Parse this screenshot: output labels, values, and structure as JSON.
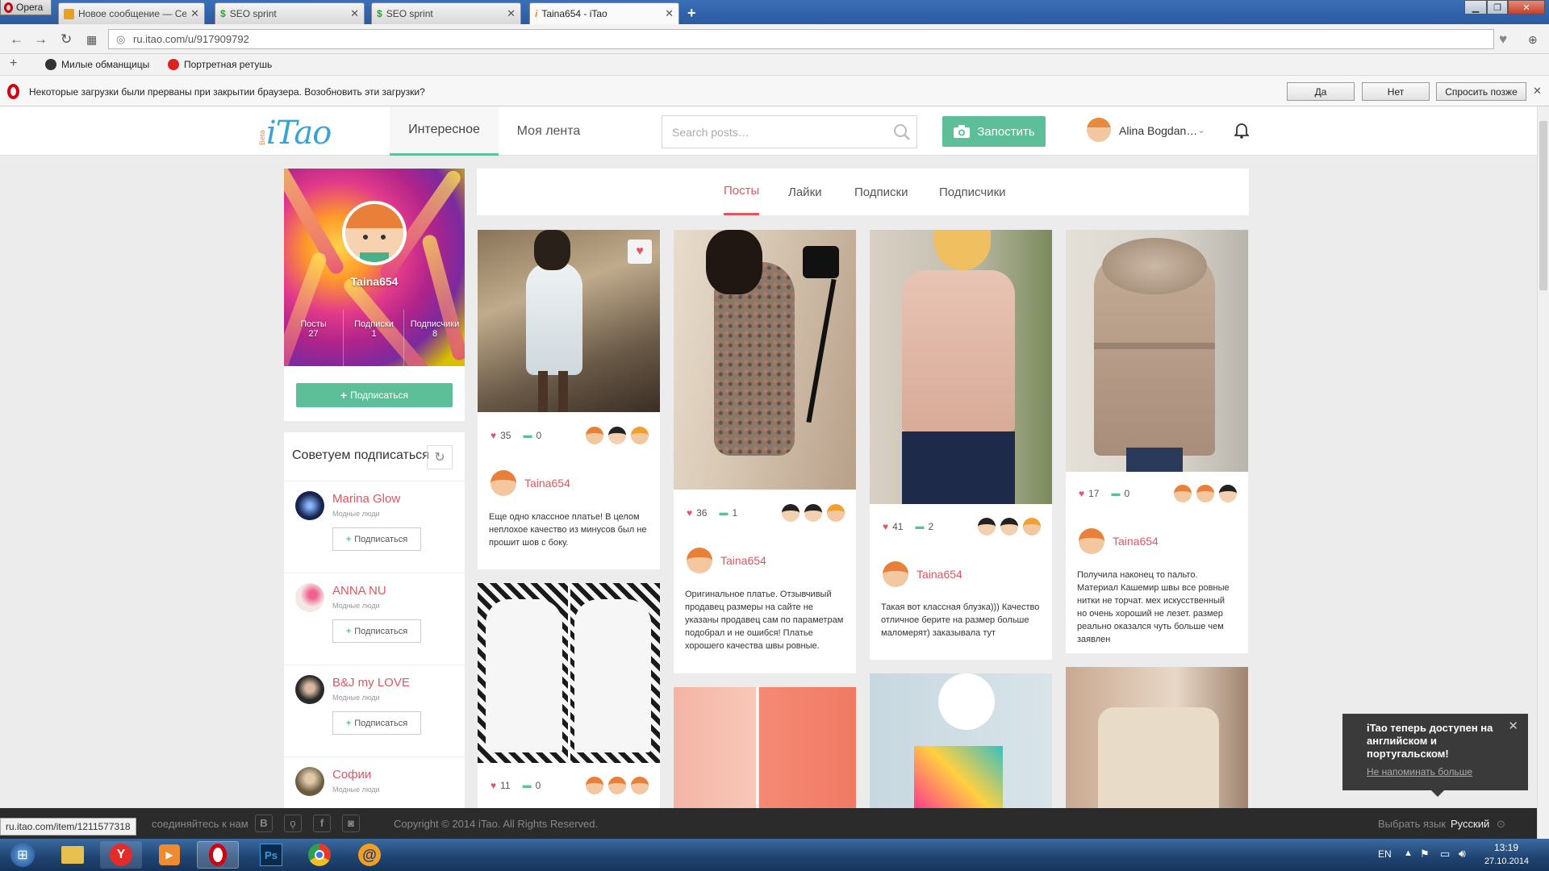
{
  "browser": {
    "opera_label": "Opera",
    "tabs": [
      {
        "title": "Новое сообщение — Се",
        "color": "#e8a020"
      },
      {
        "title": "SEO sprint",
        "color": "#3a9a3a"
      },
      {
        "title": "SEO sprint",
        "color": "#3a9a3a"
      },
      {
        "title": "Taina654 - iTao",
        "color": "#f08a3c"
      }
    ],
    "url": "ru.itao.com/u/917909792",
    "bookmarks": [
      "Милые обманщицы",
      "Портретная ретушь"
    ],
    "infobar": {
      "message": "Некоторые загрузки были прерваны при закрытии браузера. Возобновить эти загрузки?",
      "yes": "Да",
      "no": "Нет",
      "later": "Спросить позже"
    }
  },
  "site": {
    "logo": "iTao",
    "beta": "Beta",
    "nav": [
      "Интересное",
      "Моя лента"
    ],
    "search_placeholder": "Search posts…",
    "post_button": "Запостить",
    "user_name": "Alina Bogdan…"
  },
  "profile": {
    "name": "Taina654",
    "stats": [
      {
        "label": "Посты",
        "value": "27"
      },
      {
        "label": "Подписки",
        "value": "1"
      },
      {
        "label": "Подписчики",
        "value": "8"
      }
    ],
    "subscribe": "Подписаться"
  },
  "recommend": {
    "title": "Советуем подписаться",
    "items": [
      {
        "name": "Marina Glow",
        "sub": "Модные люди",
        "button": "Подписаться"
      },
      {
        "name": "ANNA NU",
        "sub": "Модные люди",
        "button": "Подписаться"
      },
      {
        "name": "B&J my LOVE",
        "sub": "Модные люди",
        "button": "Подписаться"
      },
      {
        "name": "Софии",
        "sub": "Модные люди",
        "button": ""
      }
    ]
  },
  "profile_tabs": [
    "Посты",
    "Лайки",
    "Подписки",
    "Подписчики"
  ],
  "posts": [
    {
      "likes": "35",
      "comments": "0",
      "author": "Taina654",
      "text": "Еще одно классное платье! В целом неплохое качество из минусов был не прошит шов с боку."
    },
    {
      "likes": "36",
      "comments": "1",
      "author": "Taina654",
      "text": "Оригинальное платье. Отзывчивый продавец размеры на сайте не указаны продавец сам по параметрам подобрал и не ошибся! Платье хорошего качества швы ровные."
    },
    {
      "likes": "41",
      "comments": "2",
      "author": "Taina654",
      "text": "Такая вот классная блузка))) Качество отличное берите на размер больше маломерят) заказывала тут"
    },
    {
      "likes": "17",
      "comments": "0",
      "author": "Taina654",
      "text": "Получила наконец то пальто. Материал Кашемир швы все ровные нитки не торчат. мех искусственный но очень хороший не лезет. размер реально оказался чуть больше чем заявлен"
    },
    {
      "likes": "11",
      "comments": "0"
    }
  ],
  "footer": {
    "connect": "соединяйтесь к нам",
    "copyright": "Copyright © 2014 iTao. All Rights Reserved.",
    "choose_lang": "Выбрать язык",
    "lang": "Русский",
    "status_url": "ru.itao.com/item/1211577318"
  },
  "toast": {
    "text": "iTao теперь доступен на английском и португальском!",
    "link": "Не напоминать больше"
  },
  "taskbar": {
    "lang": "EN",
    "time": "13:19",
    "date": "27.10.2014"
  }
}
